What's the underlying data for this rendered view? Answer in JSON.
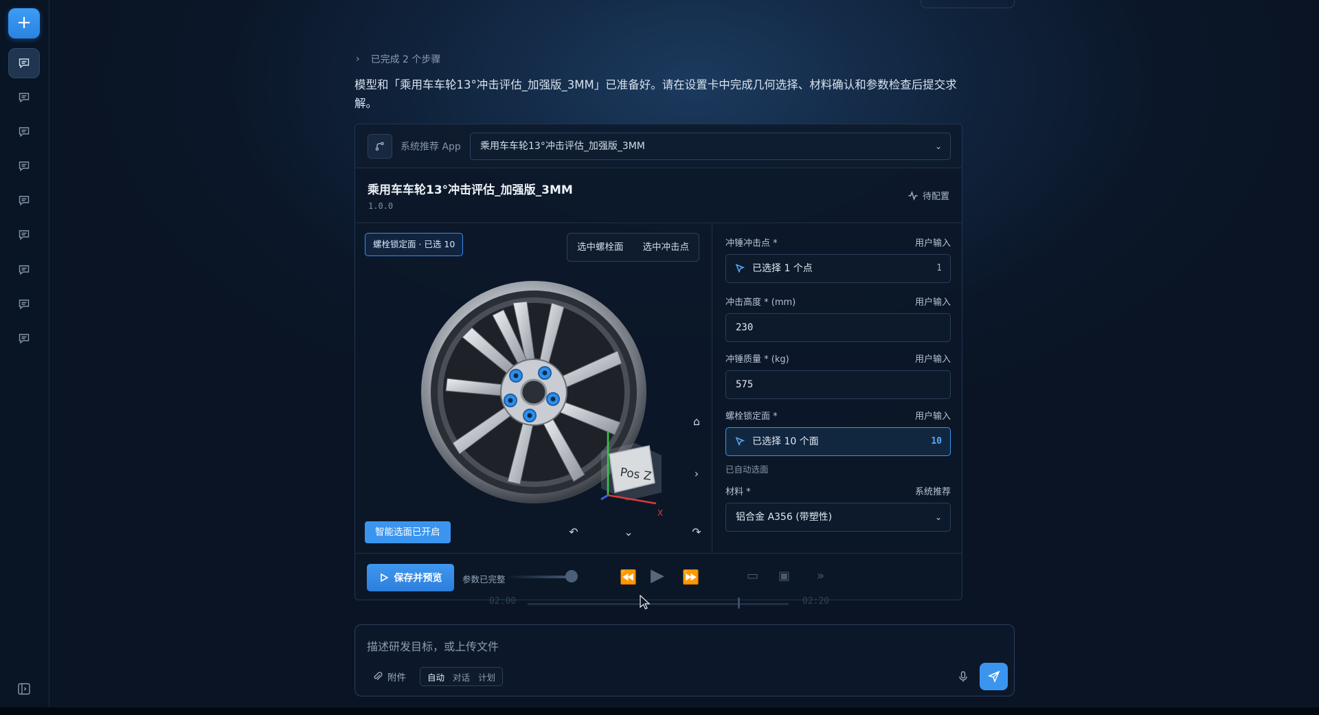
{
  "steps": {
    "label": "已完成 2 个步骤"
  },
  "intro": "模型和「乘用车车轮13°冲击评估_加强版_3MM」已准备好。请在设置卡中完成几何选择、材料确认和参数检查后提交求解。",
  "app": {
    "label": "系统推荐 App",
    "selected": "乘用车车轮13°冲击评估_加强版_3MM",
    "title": "乘用车车轮13°冲击评估_加强版_3MM",
    "version": "1.0.0",
    "status": "待配置"
  },
  "viewport": {
    "face_tag": "螺栓锁定面 · 已选 10",
    "tabs": [
      "选中螺栓面",
      "选中冲击点"
    ],
    "cube_label": "Pos Z",
    "smart_select": "智能选面已开启"
  },
  "form": {
    "fields": [
      {
        "label": "冲锤冲击点 *",
        "source": "用户输入",
        "value": "已选择 1 个点",
        "count": "1"
      },
      {
        "label": "冲击高度 * (mm)",
        "source": "用户输入",
        "value": "230"
      },
      {
        "label": "冲锤质量 * (kg)",
        "source": "用户输入",
        "value": "575"
      },
      {
        "label": "螺栓锁定面 *",
        "source": "用户输入",
        "value": "已选择 10 个面",
        "count": "10"
      },
      {
        "label": "材料 *",
        "source": "系统推荐",
        "value": "铝合金 A356 (带塑性)"
      }
    ],
    "auto_note": "已自动选面"
  },
  "footer": {
    "save_label": "保存并预览",
    "params_status": "参数已完整",
    "progress": 0.95
  },
  "timeline": {
    "start": "02:00",
    "end": "02:20"
  },
  "composer": {
    "placeholder": "描述研发目标，或上传文件",
    "attach_label": "附件",
    "modes": [
      "自动",
      "对话",
      "计划"
    ]
  },
  "colors": {
    "accent": "#3b95ef",
    "bg": "#0b1729"
  },
  "icons": [
    "plus-icon",
    "chat-icon",
    "branch-icon",
    "chevron-down-icon",
    "activity-icon",
    "home-icon",
    "chevron-right-icon",
    "rotate-icon",
    "cursor-icon",
    "play-icon",
    "paperclip-icon",
    "mic-icon",
    "send-icon",
    "panel-icon"
  ]
}
